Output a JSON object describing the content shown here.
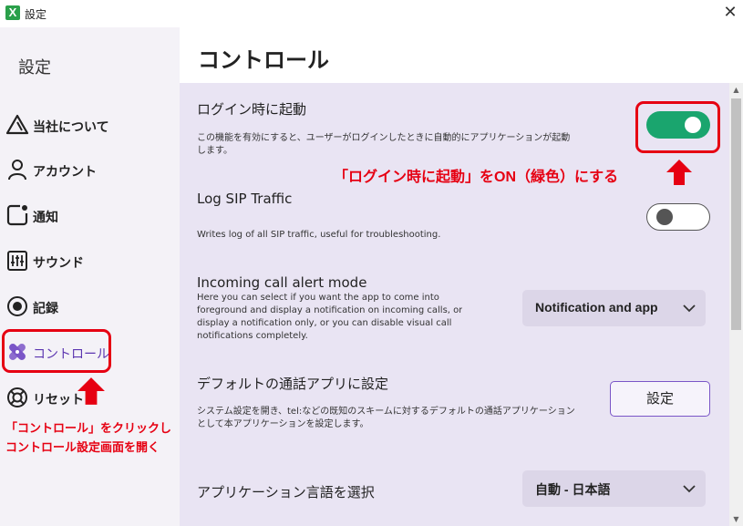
{
  "window": {
    "title": "設定",
    "app_icon_letter": "X"
  },
  "sidebar": {
    "title": "設定",
    "items": [
      {
        "label": "当社について",
        "icon": "triangle-logo-icon"
      },
      {
        "label": "アカウント",
        "icon": "user-icon"
      },
      {
        "label": "通知",
        "icon": "notification-icon"
      },
      {
        "label": "サウンド",
        "icon": "sliders-icon"
      },
      {
        "label": "記録",
        "icon": "record-icon"
      },
      {
        "label": "コントロール",
        "icon": "controls-icon",
        "active": true
      },
      {
        "label": "リセット",
        "icon": "lifebuoy-icon"
      }
    ]
  },
  "main": {
    "title": "コントロール",
    "settings": {
      "login_start": {
        "title": "ログイン時に起動",
        "desc_line1": "この機能を有効にすると、ユーザーがログインしたときに自動的にアプリケーションが起動",
        "desc_line2": "します。",
        "enabled": true
      },
      "sip_log": {
        "title": "Log SIP Traffic",
        "desc": "Writes log of all SIP traffic, useful for troubleshooting.",
        "enabled": false
      },
      "incoming_alert": {
        "title": "Incoming call alert mode",
        "desc_line1": "Here you can select if you want the app to come into",
        "desc_line2": "foreground and display a notification on incoming calls, or",
        "desc_line3": "display a notification only, or you can disable visual call",
        "desc_line4": "notifications completely.",
        "selected": "Notification and app"
      },
      "default_app": {
        "title": "デフォルトの通話アプリに設定",
        "desc_line1": "システム設定を開き、tel:などの既知のスキームに対するデフォルトの通話アプリケーション",
        "desc_line2": "として本アプリケーションを設定します。",
        "button_label": "設定"
      },
      "language": {
        "title": "アプリケーション言語を選択",
        "selected": "自動 - 日本語"
      }
    }
  },
  "annotations": {
    "toggle_note": "「ログイン時に起動」をON（緑色）にする",
    "sidebar_note_line1": "「コントロール」をクリックし",
    "sidebar_note_line2": "コントロール設定画面を開く"
  },
  "colors": {
    "accent": "#5b35b0",
    "toggle_on": "#1aa56e",
    "annotation": "#e60012"
  }
}
